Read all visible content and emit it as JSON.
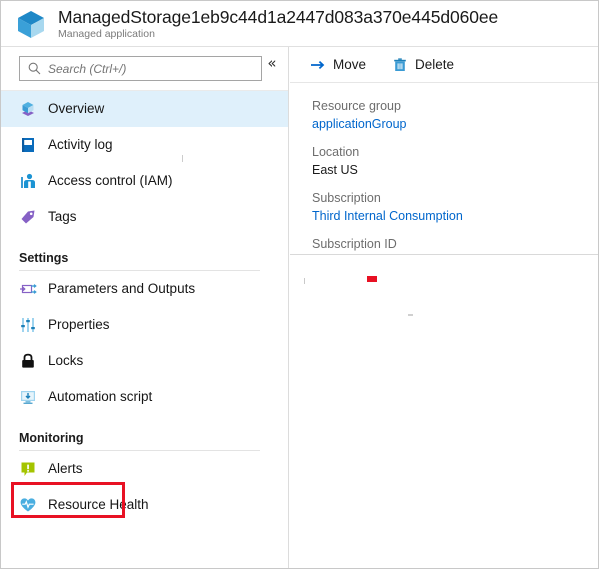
{
  "header": {
    "title": "ManagedStorage1eb9c44d1a2447d083a370e445d060ee",
    "subtitle": "Managed application",
    "icon": "managed-application-cube-icon"
  },
  "sidebar": {
    "search": {
      "placeholder": "Search (Ctrl+/)",
      "value": "",
      "icon": "search-icon"
    },
    "collapse": {
      "label": "«",
      "icon": "chevron-double-left-icon"
    },
    "items": [
      {
        "label": "Overview",
        "icon": "overview-cube-icon",
        "selected": true
      },
      {
        "label": "Activity log",
        "icon": "activity-log-book-icon",
        "selected": false
      },
      {
        "label": "Access control (IAM)",
        "icon": "access-control-person-icon",
        "selected": false
      },
      {
        "label": "Tags",
        "icon": "tag-icon",
        "selected": false
      }
    ],
    "sections": [
      {
        "title": "Settings",
        "items": [
          {
            "label": "Parameters and Outputs",
            "icon": "parameters-outputs-icon",
            "selected": false
          },
          {
            "label": "Properties",
            "icon": "properties-sliders-icon",
            "selected": false
          },
          {
            "label": "Locks",
            "icon": "lock-icon",
            "selected": false
          },
          {
            "label": "Automation script",
            "icon": "automation-script-monitor-icon",
            "selected": false
          }
        ]
      },
      {
        "title": "Monitoring",
        "items": [
          {
            "label": "Alerts",
            "icon": "alerts-bell-icon",
            "selected": false,
            "highlighted": true
          },
          {
            "label": "Resource Health",
            "icon": "resource-health-heart-icon",
            "selected": false
          }
        ]
      }
    ]
  },
  "toolbar": {
    "buttons": [
      {
        "label": "Move",
        "icon": "move-arrow-icon"
      },
      {
        "label": "Delete",
        "icon": "delete-trash-icon"
      }
    ]
  },
  "properties": [
    {
      "label": "Resource group",
      "value": "applicationGroup",
      "link": true
    },
    {
      "label": "Location",
      "value": "East US",
      "link": false
    },
    {
      "label": "Subscription",
      "value": "Third Internal Consumption",
      "link": true
    },
    {
      "label": "Subscription ID",
      "value": "",
      "link": false,
      "redacted": true
    }
  ],
  "colors": {
    "accent_link": "#0066cc",
    "selected_row": "#dff0fb",
    "highlight_border": "#e81123",
    "alert_green": "#a4c400",
    "artifact_red": "#e81123"
  }
}
